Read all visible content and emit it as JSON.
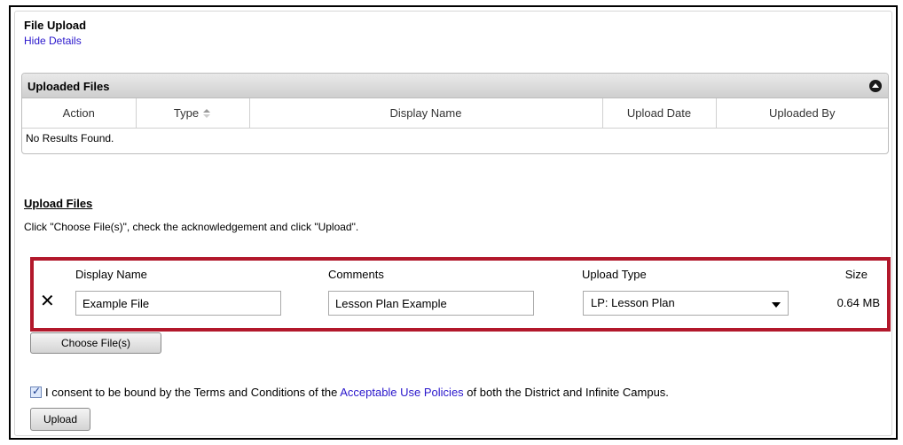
{
  "section": {
    "title": "File Upload",
    "toggle_link": "Hide Details"
  },
  "uploaded_files": {
    "title": "Uploaded Files",
    "columns": [
      "Action",
      "Type",
      "Display Name",
      "Upload Date",
      "Uploaded By"
    ],
    "sorted_column": "Type",
    "empty_message": "No Results Found."
  },
  "upload": {
    "heading": "Upload Files",
    "instructions": "Click \"Choose File(s)\", check the acknowledgement and click \"Upload\".",
    "columns": {
      "display_name": "Display Name",
      "comments": "Comments",
      "upload_type": "Upload Type",
      "size": "Size"
    },
    "file": {
      "remove_symbol": "✕",
      "display_name": "Example File",
      "comments": "Lesson Plan Example",
      "upload_type": "LP: Lesson Plan",
      "size": "0.64 MB"
    },
    "choose_button": "Choose File(s)",
    "consent_checked": true,
    "consent_prefix": "I consent to be bound by the Terms and Conditions of the ",
    "consent_link": "Acceptable Use Policies",
    "consent_suffix": " of both the District and Infinite Campus.",
    "upload_button": "Upload"
  },
  "colors": {
    "highlight_border": "#b2182b",
    "link": "#2a17cc"
  }
}
